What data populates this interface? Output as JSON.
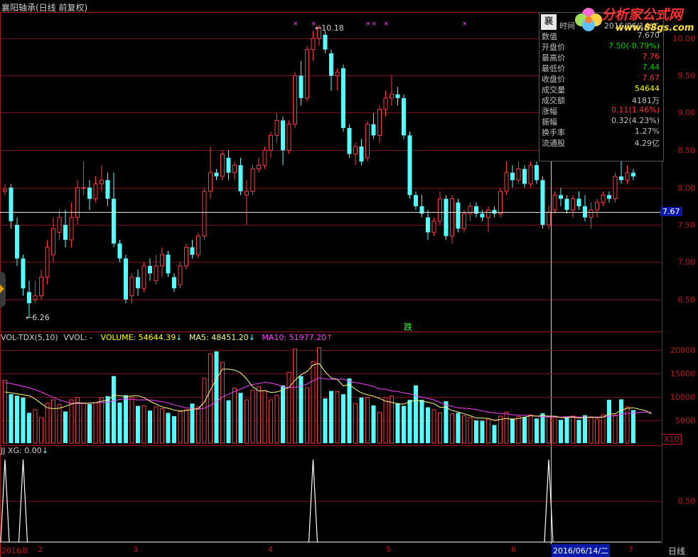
{
  "title": "襄阳轴承(日线 前复权)",
  "price_axis": [
    "10.00",
    "9.50",
    "9.00",
    "8.50",
    "8.00",
    "7.50",
    "7.00",
    "6.50"
  ],
  "last_price_tag": "7.67",
  "high_label": "10.18",
  "low_label": "6.26",
  "signal_label": "跌",
  "volume_indicator": {
    "name": "VOL-TDX(5,10)",
    "vvol": "VVOL: -",
    "volume": "VOLUME: 54644.39",
    "ma5": "MA5: 48451.20",
    "ma10": "MA10: 51977.20"
  },
  "volume_axis": [
    "20000",
    "15000",
    "10000",
    "5000"
  ],
  "volume_unit": "X10",
  "jj_indicator": {
    "label": "JJ  XG: 0.00"
  },
  "jj_axis": [
    "0.50"
  ],
  "bottom_axis": {
    "year": "2016年",
    "months": [
      "2",
      "3",
      "4",
      "5",
      "6",
      "7"
    ],
    "cursor_date": "2016/06/14/二",
    "period": "日线"
  },
  "info_panel": {
    "badge": "襄",
    "time_label": "时间",
    "time_value": "2016/06/14/二",
    "rows": [
      {
        "label": "数值",
        "value": "7.670",
        "color": "#c0c0c0"
      },
      {
        "label": "开盘价",
        "value": "7.50(-0.79%)",
        "color": "#00d000"
      },
      {
        "label": "最高价",
        "value": "7.76",
        "color": "#ff3030"
      },
      {
        "label": "最低价",
        "value": "7.44",
        "color": "#00d000"
      },
      {
        "label": "收盘价",
        "value": "7.67",
        "color": "#ff3030"
      },
      {
        "label": "成交量",
        "value": "54644",
        "color": "#ffff00"
      },
      {
        "label": "成交额",
        "value": "4181万",
        "color": "#c0c0c0"
      },
      {
        "label": "涨幅",
        "value": "0.11(1.46%)",
        "color": "#ff3030"
      },
      {
        "label": "振幅",
        "value": "0.32(4.23%)",
        "color": "#c0c0c0"
      },
      {
        "label": "换手率",
        "value": "1.27%",
        "color": "#c0c0c0"
      },
      {
        "label": "流通股",
        "value": "4.29亿",
        "color": "#c0c0c0"
      }
    ]
  },
  "logo": {
    "text": "分析家公式网",
    "url": "www.88gs.com"
  },
  "colors": {
    "up": "#ff3c3c",
    "down": "#54ffff",
    "ma5": "#ffff80",
    "ma10": "#ff40ff",
    "grid": "#7a1212"
  },
  "chart_data": {
    "type": "candlestick",
    "candles": [
      [
        7.95,
        8.05,
        7.9,
        7.98
      ],
      [
        8.0,
        8.05,
        7.45,
        7.55
      ],
      [
        7.5,
        7.6,
        6.95,
        7.05
      ],
      [
        7.05,
        7.1,
        6.55,
        6.65
      ],
      [
        6.6,
        6.75,
        6.26,
        6.45
      ],
      [
        6.5,
        6.75,
        6.45,
        6.55
      ],
      [
        6.55,
        6.9,
        6.5,
        6.8
      ],
      [
        6.8,
        7.3,
        6.7,
        7.2
      ],
      [
        7.1,
        7.6,
        7.0,
        7.45
      ],
      [
        7.4,
        7.7,
        7.3,
        7.6
      ],
      [
        7.5,
        7.7,
        7.2,
        7.3
      ],
      [
        7.3,
        7.8,
        7.2,
        7.6
      ],
      [
        7.6,
        8.1,
        7.5,
        8.0
      ],
      [
        8.0,
        8.35,
        7.9,
        8.0
      ],
      [
        8.0,
        8.1,
        7.7,
        7.85
      ],
      [
        7.85,
        8.15,
        7.8,
        8.05
      ],
      [
        8.05,
        8.3,
        7.95,
        8.1
      ],
      [
        8.1,
        8.2,
        7.75,
        7.85
      ],
      [
        7.85,
        8.2,
        7.2,
        7.25
      ],
      [
        7.25,
        7.3,
        7.0,
        7.05
      ],
      [
        7.05,
        7.1,
        6.45,
        6.5
      ],
      [
        6.55,
        6.85,
        6.45,
        6.8
      ],
      [
        6.8,
        6.9,
        6.55,
        6.65
      ],
      [
        6.65,
        7.0,
        6.6,
        6.95
      ],
      [
        6.95,
        7.05,
        6.75,
        6.85
      ],
      [
        6.75,
        7.1,
        6.7,
        6.95
      ],
      [
        6.95,
        7.2,
        6.8,
        7.1
      ],
      [
        7.1,
        7.15,
        6.8,
        6.85
      ],
      [
        6.8,
        6.85,
        6.6,
        6.65
      ],
      [
        6.7,
        7.0,
        6.65,
        6.95
      ],
      [
        6.95,
        7.25,
        6.9,
        7.2
      ],
      [
        7.2,
        7.3,
        7.05,
        7.1
      ],
      [
        7.1,
        7.4,
        7.05,
        7.35
      ],
      [
        7.35,
        8.0,
        7.3,
        7.95
      ],
      [
        7.95,
        8.55,
        7.85,
        8.2
      ],
      [
        8.2,
        8.25,
        8.1,
        8.15
      ],
      [
        8.15,
        8.5,
        8.1,
        8.45
      ],
      [
        8.4,
        8.5,
        8.1,
        8.2
      ],
      [
        8.2,
        8.35,
        8.1,
        8.3
      ],
      [
        8.3,
        8.4,
        7.9,
        7.95
      ],
      [
        7.9,
        8.1,
        7.5,
        7.95
      ],
      [
        7.95,
        8.3,
        7.9,
        8.25
      ],
      [
        8.25,
        8.4,
        8.2,
        8.3
      ],
      [
        8.3,
        8.55,
        8.25,
        8.5
      ],
      [
        8.5,
        8.75,
        8.4,
        8.7
      ],
      [
        8.7,
        9.0,
        8.6,
        8.9
      ],
      [
        8.9,
        8.95,
        8.3,
        8.5
      ],
      [
        8.5,
        8.9,
        8.45,
        8.85
      ],
      [
        8.85,
        9.55,
        8.8,
        9.5
      ],
      [
        9.5,
        9.7,
        9.1,
        9.2
      ],
      [
        9.2,
        9.9,
        9.15,
        9.85
      ],
      [
        9.85,
        10.1,
        9.7,
        10.0
      ],
      [
        10.0,
        10.18,
        9.9,
        10.15
      ],
      [
        10.05,
        10.1,
        9.8,
        9.85
      ],
      [
        9.8,
        9.85,
        9.3,
        9.5
      ],
      [
        9.5,
        9.6,
        9.3,
        9.55
      ],
      [
        9.6,
        9.65,
        8.75,
        8.8
      ],
      [
        8.8,
        8.85,
        8.4,
        8.45
      ],
      [
        8.45,
        8.6,
        8.3,
        8.55
      ],
      [
        8.55,
        8.65,
        8.3,
        8.35
      ],
      [
        8.4,
        8.9,
        8.35,
        8.85
      ],
      [
        8.85,
        9.0,
        8.65,
        8.7
      ],
      [
        8.7,
        9.1,
        8.6,
        9.05
      ],
      [
        9.05,
        9.3,
        8.95,
        9.2
      ],
      [
        9.2,
        9.5,
        9.1,
        9.25
      ],
      [
        9.25,
        9.35,
        9.1,
        9.2
      ],
      [
        9.2,
        9.25,
        8.65,
        8.7
      ],
      [
        8.7,
        8.75,
        7.85,
        7.9
      ],
      [
        7.9,
        7.95,
        7.7,
        7.75
      ],
      [
        7.75,
        7.9,
        7.6,
        7.65
      ],
      [
        7.6,
        7.7,
        7.3,
        7.4
      ],
      [
        7.4,
        7.6,
        7.35,
        7.55
      ],
      [
        7.55,
        7.95,
        7.5,
        7.85
      ],
      [
        7.85,
        7.9,
        7.3,
        7.35
      ],
      [
        7.35,
        7.9,
        7.25,
        7.85
      ],
      [
        7.8,
        7.85,
        7.4,
        7.45
      ],
      [
        7.45,
        7.7,
        7.4,
        7.65
      ],
      [
        7.65,
        7.8,
        7.55,
        7.75
      ],
      [
        7.75,
        7.8,
        7.6,
        7.65
      ],
      [
        7.65,
        7.7,
        7.55,
        7.6
      ],
      [
        7.6,
        7.75,
        7.4,
        7.7
      ],
      [
        7.7,
        7.75,
        7.6,
        7.65
      ],
      [
        7.65,
        8.0,
        7.6,
        7.95
      ],
      [
        7.95,
        8.35,
        7.9,
        8.2
      ],
      [
        8.2,
        8.3,
        8.0,
        8.1
      ],
      [
        8.1,
        8.35,
        8.05,
        8.25
      ],
      [
        8.25,
        8.3,
        8.0,
        8.05
      ],
      [
        8.05,
        8.35,
        8.0,
        8.3
      ],
      [
        8.3,
        8.35,
        8.05,
        8.1
      ],
      [
        8.1,
        8.15,
        7.45,
        7.5
      ],
      [
        7.5,
        7.76,
        7.44,
        7.67
      ],
      [
        7.7,
        7.95,
        7.65,
        7.9
      ],
      [
        7.9,
        8.0,
        7.75,
        7.85
      ],
      [
        7.85,
        7.9,
        7.65,
        7.7
      ],
      [
        7.7,
        7.9,
        7.6,
        7.85
      ],
      [
        7.85,
        7.95,
        7.7,
        7.75
      ],
      [
        7.75,
        7.9,
        7.55,
        7.6
      ],
      [
        7.6,
        7.8,
        7.45,
        7.7
      ],
      [
        7.7,
        7.85,
        7.6,
        7.8
      ],
      [
        7.8,
        7.95,
        7.75,
        7.9
      ],
      [
        7.9,
        7.95,
        7.8,
        7.85
      ],
      [
        7.85,
        8.2,
        7.8,
        8.15
      ],
      [
        8.15,
        8.35,
        8.05,
        8.1
      ],
      [
        8.1,
        8.3,
        8.05,
        8.2
      ],
      [
        8.2,
        8.25,
        8.1,
        8.15
      ]
    ],
    "volume": [
      13500,
      10500,
      10200,
      9800,
      6500,
      7200,
      5500,
      8600,
      9300,
      8300,
      6800,
      9300,
      9800,
      8600,
      8400,
      8700,
      9800,
      10100,
      14400,
      8700,
      10300,
      9800,
      8000,
      8000,
      7000,
      7800,
      7400,
      6500,
      5800,
      6800,
      7200,
      8500,
      7800,
      13900,
      19200,
      19700,
      17400,
      9200,
      11800,
      10800,
      9300,
      11400,
      12100,
      11300,
      9300,
      10300,
      12400,
      15200,
      20200,
      14400,
      11900,
      17500,
      20500,
      9600,
      11200,
      11100,
      10500,
      13900,
      8500,
      9800,
      9800,
      8100,
      6600,
      9800,
      10100,
      8600,
      8000,
      9300,
      12400,
      9300,
      7700,
      7200,
      6500,
      9000,
      6300,
      6500,
      5900,
      5500,
      4900,
      4800,
      5200,
      3900,
      5800,
      6700,
      5300,
      5700,
      5600,
      6100,
      5300,
      6400,
      5700,
      5600,
      5000,
      5600,
      5800,
      5000,
      6000,
      5500,
      5200,
      6100,
      9300,
      6000,
      9400,
      7800,
      7100,
      6000,
      5500,
      4000
    ],
    "ma5": [
      11000,
      10800,
      10600,
      10400,
      10200,
      9500,
      8500,
      7600,
      7400,
      7500,
      7900,
      8400,
      8700,
      8600,
      8600,
      8700,
      9000,
      9200,
      10300,
      10200,
      10000,
      10100,
      10200,
      9800,
      9000,
      8400,
      7800,
      7500,
      7100,
      6900,
      7000,
      7300,
      7400,
      8800,
      11400,
      13800,
      15900,
      15900,
      15700,
      15100,
      13800,
      12100,
      11200,
      11300,
      10900,
      11000,
      11400,
      12000,
      13500,
      14700,
      15400,
      16800,
      17100,
      15300,
      14000,
      13700,
      12300,
      12600,
      11600,
      10800,
      10400,
      10100,
      9600,
      9000,
      8800,
      8400,
      8400,
      8900,
      9200,
      9000,
      8800,
      8500,
      7700,
      7700,
      7000,
      6700,
      6300,
      5900,
      5400,
      5400,
      5300,
      4900,
      5100,
      5300,
      5100,
      5300,
      5600,
      5900,
      5800,
      5900,
      5800,
      5800,
      5500,
      5500,
      5600,
      5400,
      5500,
      5600,
      5500,
      5600,
      6300,
      6300,
      7100,
      7500,
      7600,
      7300,
      7000,
      6300
    ],
    "ma10": [
      13000,
      12800,
      12500,
      12200,
      11900,
      11500,
      11000,
      10400,
      9800,
      9300,
      8900,
      8600,
      8500,
      8500,
      8600,
      8700,
      8700,
      8800,
      9100,
      9400,
      9500,
      9400,
      9300,
      9300,
      9300,
      9100,
      8900,
      8600,
      8200,
      7900,
      7600,
      7400,
      7300,
      7500,
      8100,
      8900,
      9900,
      10500,
      11100,
      11600,
      12200,
      12600,
      12800,
      13100,
      12900,
      12600,
      12100,
      11900,
      12000,
      12200,
      12700,
      13400,
      14000,
      13800,
      13700,
      13700,
      13800,
      13200,
      13000,
      12800,
      12500,
      12200,
      11600,
      11600,
      11200,
      11100,
      10800,
      10600,
      10200,
      9900,
      9600,
      9300,
      8800,
      8200,
      7900,
      7600,
      7500,
      7400,
      7200,
      6900,
      6700,
      6500,
      6400,
      6300,
      6100,
      6000,
      6000,
      5900,
      5800,
      5700,
      5600,
      5600,
      5600,
      5700,
      5700,
      5600,
      5600,
      5600,
      5600,
      5600,
      5800,
      5900,
      6200,
      6400,
      6500,
      6600,
      6700,
      6600
    ],
    "xg_signal_days": [
      0,
      3,
      51,
      90
    ],
    "price_ylim": [
      6.25,
      10.25
    ],
    "volume_ylim": [
      0,
      21000
    ]
  }
}
